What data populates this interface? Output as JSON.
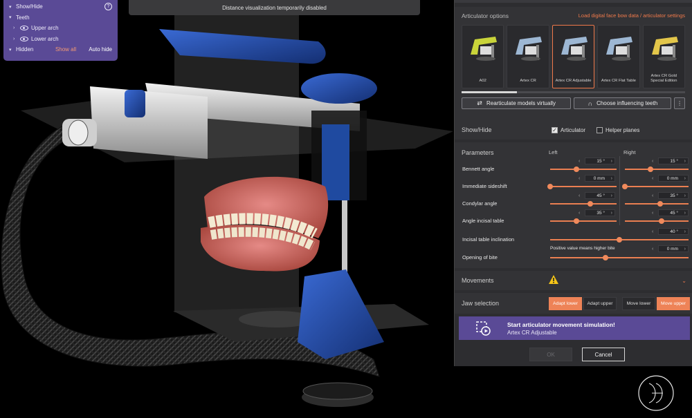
{
  "notice": "Distance visualization temporarily disabled",
  "overlay": {
    "title": "Show/Hide",
    "help": "?",
    "teeth": "Teeth",
    "upper": "Upper arch",
    "lower": "Lower arch",
    "hidden": "Hidden",
    "show_all": "Show all",
    "auto_hide": "Auto hide"
  },
  "articulator": {
    "header": "Articulator options",
    "load_link": "Load digital face bow data / articulator settings",
    "models": [
      {
        "label": "A02",
        "color": "#c9d43a"
      },
      {
        "label": "Artex CR",
        "color": "#9db7d3"
      },
      {
        "label": "Artex CR Adjustable",
        "color": "#9db7d3",
        "selected": true
      },
      {
        "label": "Artex CR Flat Table",
        "color": "#9db7d3"
      },
      {
        "label": "Artex CR Gold Special Edition",
        "color": "#e3c64a"
      }
    ],
    "rearticulate": "Rearticulate models virtually",
    "influencing": "Choose influencing teeth",
    "more": "⋮"
  },
  "showhide": {
    "title": "Show/Hide",
    "articulator_label": "Articulator",
    "articulator_checked": true,
    "helper_label": "Helper planes",
    "helper_checked": false
  },
  "parameters": {
    "title": "Parameters",
    "left": "Left",
    "right": "Right",
    "rows": [
      {
        "label": "Bennett angle",
        "left_value": "15 °",
        "right_value": "15 °",
        "left_level": 0.4,
        "right_level": 0.4
      },
      {
        "label": "Immediate sideshift",
        "left_value": "0 mm",
        "right_value": "0 mm",
        "left_level": 0.0,
        "right_level": 0.0
      },
      {
        "label": "Condylar angle",
        "left_value": "45 °",
        "right_value": "35 °",
        "left_level": 0.6,
        "right_level": 0.55
      },
      {
        "label": "Angle incisal table",
        "left_value": "35 °",
        "right_value": "45 °",
        "left_level": 0.4,
        "right_level": 0.58
      }
    ],
    "incisal_label": "Incisal table inclination",
    "incisal_value": "40 °",
    "incisal_level": 0.5,
    "bite_hint": "Positive value means higher bite",
    "bite_label": "Opening of bite",
    "bite_value": "0 mm",
    "bite_level": 0.4
  },
  "movements": {
    "title": "Movements",
    "warning_icon": "warning-icon",
    "caret": "⌄"
  },
  "jaw": {
    "title": "Jaw selection",
    "adapt_lower": "Adapt lower",
    "adapt_upper": "Adapt upper",
    "move_lower": "Move lower",
    "move_upper": "Move upper"
  },
  "simulation": {
    "title": "Start articulator movement simulation!",
    "subtitle": "Artex CR Adjustable"
  },
  "dialog": {
    "ok": "OK",
    "cancel": "Cancel"
  },
  "colors": {
    "accent": "#f07a4b",
    "purple": "#5a4a96",
    "panel": "#2d2d30",
    "blue_part": "#1f4aa0"
  }
}
